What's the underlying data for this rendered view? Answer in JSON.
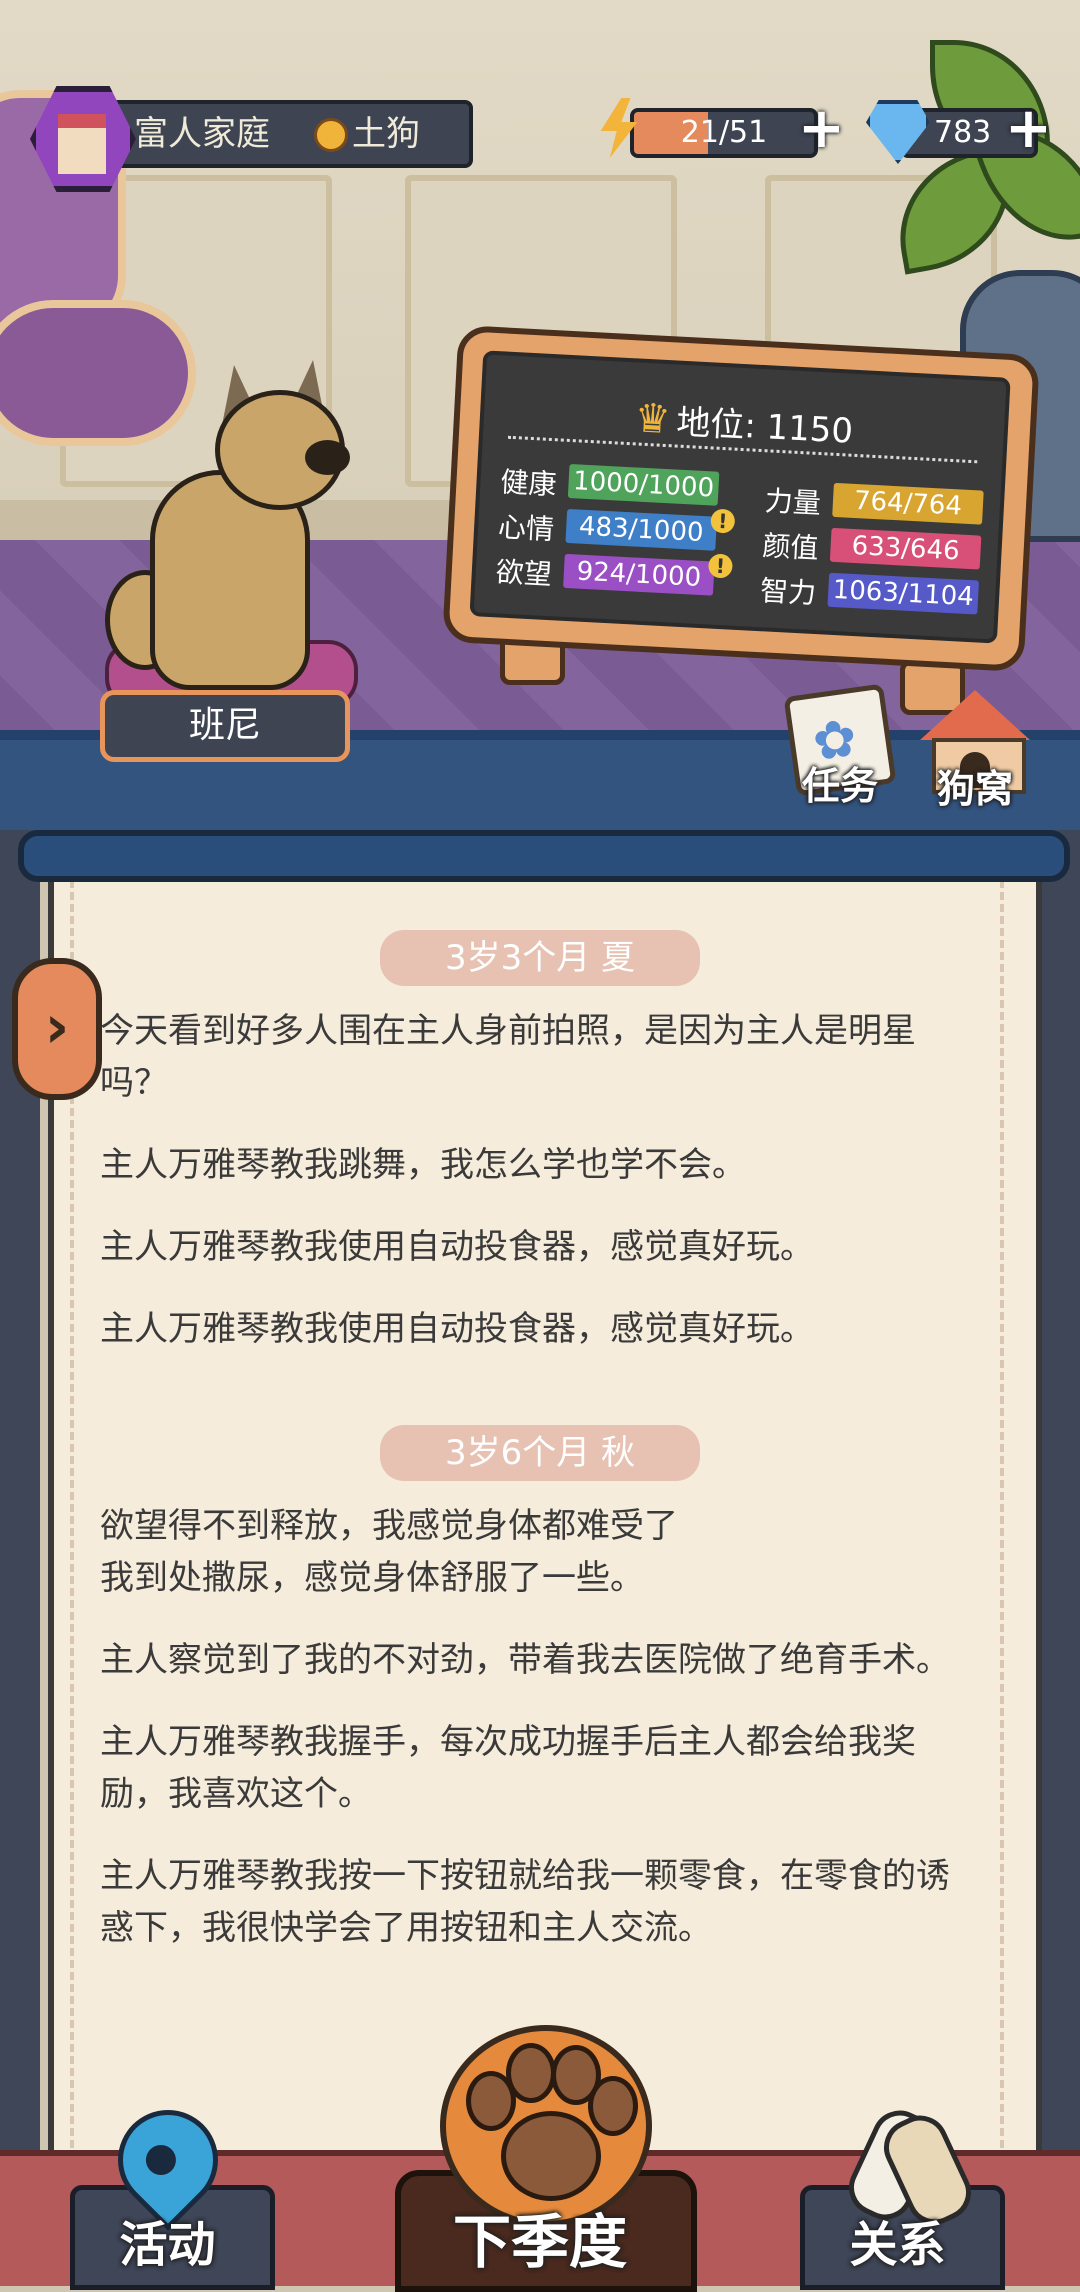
{
  "header": {
    "home_name": "富人家庭",
    "rank_label": "土狗",
    "energy": {
      "current": 21,
      "max": 51,
      "text": "21/51"
    },
    "gems": "783",
    "plus_glyph": "+"
  },
  "pet": {
    "name": "班尼"
  },
  "status": {
    "title": "地位: 1150",
    "stats": [
      {
        "label": "健康",
        "value": "1000/1000",
        "color": "#4fa35b",
        "warn": false
      },
      {
        "label": "心情",
        "value": "483/1000",
        "color": "#3f7fc7",
        "warn": true
      },
      {
        "label": "欲望",
        "value": "924/1000",
        "color": "#9b4fc5",
        "warn": true
      },
      {
        "label": "力量",
        "value": "764/764",
        "color": "#d9a531",
        "warn": false
      },
      {
        "label": "颜值",
        "value": "633/646",
        "color": "#d84f78",
        "warn": false
      },
      {
        "label": "智力",
        "value": "1063/1104",
        "color": "#5659c8",
        "warn": false
      }
    ]
  },
  "quick_buttons": {
    "task": "任务",
    "kennel": "狗窝"
  },
  "diary": {
    "sections": [
      {
        "tag": "3岁3个月 夏",
        "entries": [
          "今天看到好多人围在主人身前拍照，是因为主人是明星吗？",
          "主人万雅琴教我跳舞，我怎么学也学不会。",
          "主人万雅琴教我使用自动投食器，感觉真好玩。",
          "主人万雅琴教我使用自动投食器，感觉真好玩。"
        ]
      },
      {
        "tag": "3岁6个月 秋",
        "entries": [
          "欲望得不到释放，我感觉身体都难受了\n我到处撒尿，感觉身体舒服了一些。",
          "主人察觉到了我的不对劲，带着我去医院做了绝育手术。",
          "主人万雅琴教我握手，每次成功握手后主人都会给我奖励，我喜欢这个。",
          "主人万雅琴教我按一下按钮就给我一颗零食，在零食的诱惑下，我很快学会了用按钮和主人交流。"
        ]
      }
    ]
  },
  "nav": {
    "activity": "活动",
    "next_season": "下季度",
    "relation": "关系"
  }
}
